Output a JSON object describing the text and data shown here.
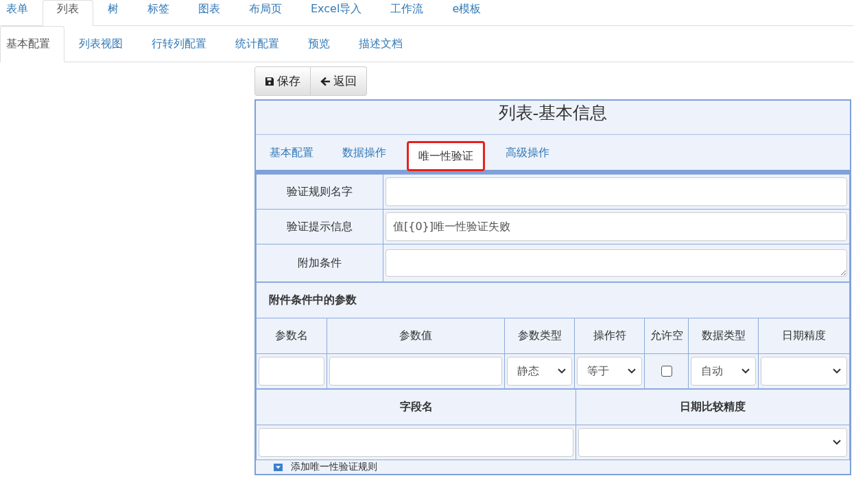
{
  "top_tabs": [
    {
      "label": "表单",
      "selected": false
    },
    {
      "label": "列表",
      "selected": true
    },
    {
      "label": "树",
      "selected": false
    },
    {
      "label": "标签",
      "selected": false
    },
    {
      "label": "图表",
      "selected": false
    },
    {
      "label": "布局页",
      "selected": false
    },
    {
      "label": "Excel导入",
      "selected": false
    },
    {
      "label": "工作流",
      "selected": false
    },
    {
      "label": "e模板",
      "selected": false
    }
  ],
  "sub_tabs": [
    {
      "label": "基本配置",
      "selected": true
    },
    {
      "label": "列表视图",
      "selected": false
    },
    {
      "label": "行转列配置",
      "selected": false
    },
    {
      "label": "统计配置",
      "selected": false
    },
    {
      "label": "预览",
      "selected": false
    },
    {
      "label": "描述文档",
      "selected": false
    }
  ],
  "toolbar": [
    {
      "label": "保存",
      "kind": "save"
    },
    {
      "label": "返回",
      "kind": "back"
    }
  ],
  "panel": {
    "title": "列表-基本信息",
    "tabs": [
      {
        "label": "基本配置",
        "selected": false
      },
      {
        "label": "数据操作",
        "selected": false
      },
      {
        "label": "唯一性验证",
        "selected": true
      },
      {
        "label": "高级操作",
        "selected": false
      }
    ],
    "fields": [
      {
        "label": "验证规则名字",
        "kind": "input"
      },
      {
        "label": "验证提示信息",
        "kind": "input",
        "value": "值[{0}]唯一性验证失败"
      },
      {
        "label": "附加条件",
        "kind": "textarea"
      }
    ],
    "params": {
      "title": "附件条件中的参数",
      "columns": [
        "参数名",
        "参数值",
        "参数类型",
        "操作符",
        "允许空",
        "数据类型",
        "日期精度"
      ],
      "row": [
        {
          "kind": "input"
        },
        {
          "kind": "input"
        },
        {
          "kind": "select",
          "value": "静态"
        },
        {
          "kind": "select",
          "value": "等于"
        },
        {
          "kind": "checkbox",
          "checked": false
        },
        {
          "kind": "select",
          "value": "自动"
        },
        {
          "kind": "select"
        }
      ]
    },
    "compare": {
      "columns": [
        "字段名",
        "日期比较精度"
      ],
      "row": [
        {
          "kind": "input"
        },
        {
          "kind": "select"
        }
      ]
    },
    "add_rule": "添加唯一性验证规则"
  }
}
